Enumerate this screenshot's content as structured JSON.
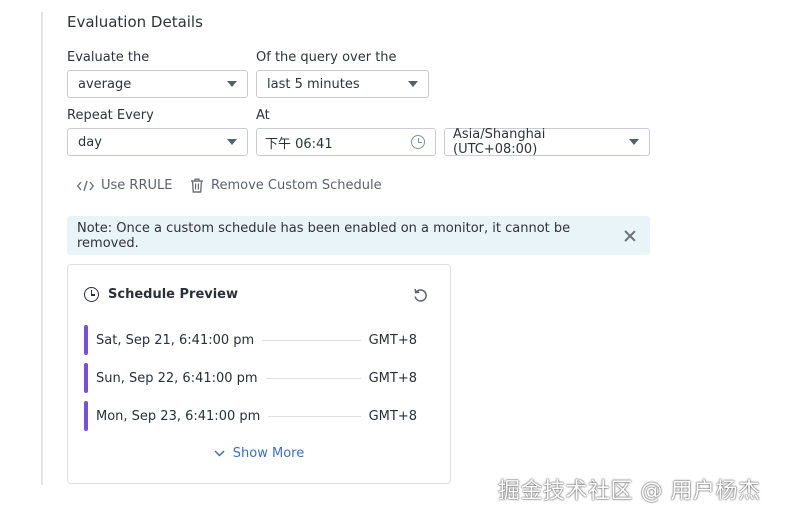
{
  "section": {
    "title": "Evaluation Details"
  },
  "evaluate": {
    "label": "Evaluate the",
    "value": "average"
  },
  "query_window": {
    "label": "Of the query over the",
    "value": "last 5 minutes"
  },
  "repeat": {
    "label": "Repeat Every",
    "value": "day"
  },
  "at": {
    "label": "At",
    "value": "下午 06:41"
  },
  "timezone": {
    "value": "Asia/Shanghai (UTC+08:00)"
  },
  "actions": {
    "rrule_label": "Use RRULE",
    "remove_label": "Remove Custom Schedule"
  },
  "note": {
    "text": "Note: Once a custom schedule has been enabled on a monitor, it cannot be removed."
  },
  "preview": {
    "title": "Schedule Preview",
    "rows": [
      {
        "date": "Sat, Sep 21, 6:41:00 pm",
        "tz": "GMT+8"
      },
      {
        "date": "Sun, Sep 22, 6:41:00 pm",
        "tz": "GMT+8"
      },
      {
        "date": "Mon, Sep 23, 6:41:00 pm",
        "tz": "GMT+8"
      }
    ],
    "show_more": "Show More"
  },
  "colors": {
    "accent_bar": "#7a4fd6",
    "link": "#3b6fc4",
    "note_bg": "#e8f4f8"
  },
  "watermark": {
    "text": "掘金技术社区 @ 用户杨杰"
  }
}
